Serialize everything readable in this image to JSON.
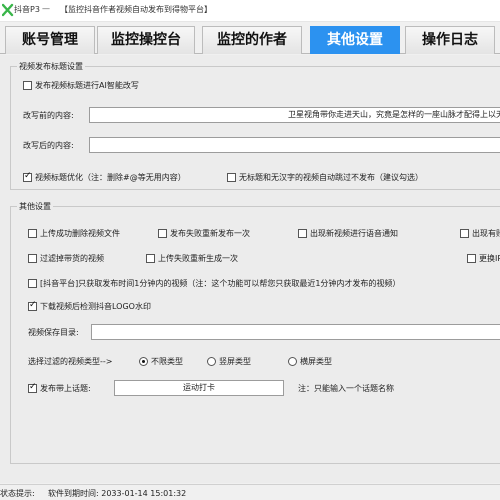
{
  "window": {
    "app_name": "抖音P3",
    "separator": "—",
    "title": "【监控抖音作者视频自动发布到得物平台】"
  },
  "tabs": [
    {
      "label": "账号管理",
      "active": false
    },
    {
      "label": "监控操控台",
      "active": false
    },
    {
      "label": "监控的作者",
      "active": false
    },
    {
      "label": "其他设置",
      "active": true
    },
    {
      "label": "操作日志",
      "active": false
    }
  ],
  "title_settings": {
    "group_label": "视频发布标题设置",
    "ai_rewrite": {
      "label": "发布视频标题进行AI智能改写",
      "checked": false
    },
    "before_label": "改写前的内容:",
    "before_value": "卫星视角带你走进天山，究竟是怎样的一座山脉才配得上以天",
    "after_label": "改写后的内容:",
    "after_value": "",
    "optimize": {
      "label": "视频标题优化（注：删除#@等无用内容）",
      "checked": true
    },
    "skip_no_title": {
      "label": "无标题和无汉字的视频自动跳过不发布（建议勾选）",
      "checked": false
    }
  },
  "other_settings": {
    "group_label": "其他设置",
    "options": [
      {
        "label": "上传成功删除视频文件",
        "checked": false
      },
      {
        "label": "发布失败重新发布一次",
        "checked": false
      },
      {
        "label": "出现新视频进行语音通知",
        "checked": false
      },
      {
        "label": "出现有账",
        "checked": false
      },
      {
        "label": "过滤掉带货的视频",
        "checked": false
      },
      {
        "label": "上传失败重新生成一次",
        "checked": false
      },
      {
        "label": "更换IP",
        "checked": false
      },
      {
        "label": "[抖音平台]只获取发布时间1分钟内的视频（注：这个功能可以帮您只获取最近1分钟内才发布的视频）",
        "checked": false
      },
      {
        "label": "下载视频后检测抖音LOGO水印",
        "checked": true
      }
    ],
    "save_dir_label": "视频保存目录:",
    "save_dir_value": "",
    "filter_type_label": "选择过滤的视频类型-->",
    "filter_types": [
      {
        "label": "不限类型",
        "selected": true
      },
      {
        "label": "竖屏类型",
        "selected": false
      },
      {
        "label": "横屏类型",
        "selected": false
      }
    ],
    "topic": {
      "label": "发布带上话题:",
      "checked": true
    },
    "topic_value": "运动打卡",
    "topic_note": "注：只能输入一个话题名称"
  },
  "status": {
    "label": "状态提示:",
    "text": "软件到期时间: 2033-01-14 15:01:32"
  },
  "colors": {
    "accent": "#2c92f0",
    "logo": "#39b54a"
  }
}
